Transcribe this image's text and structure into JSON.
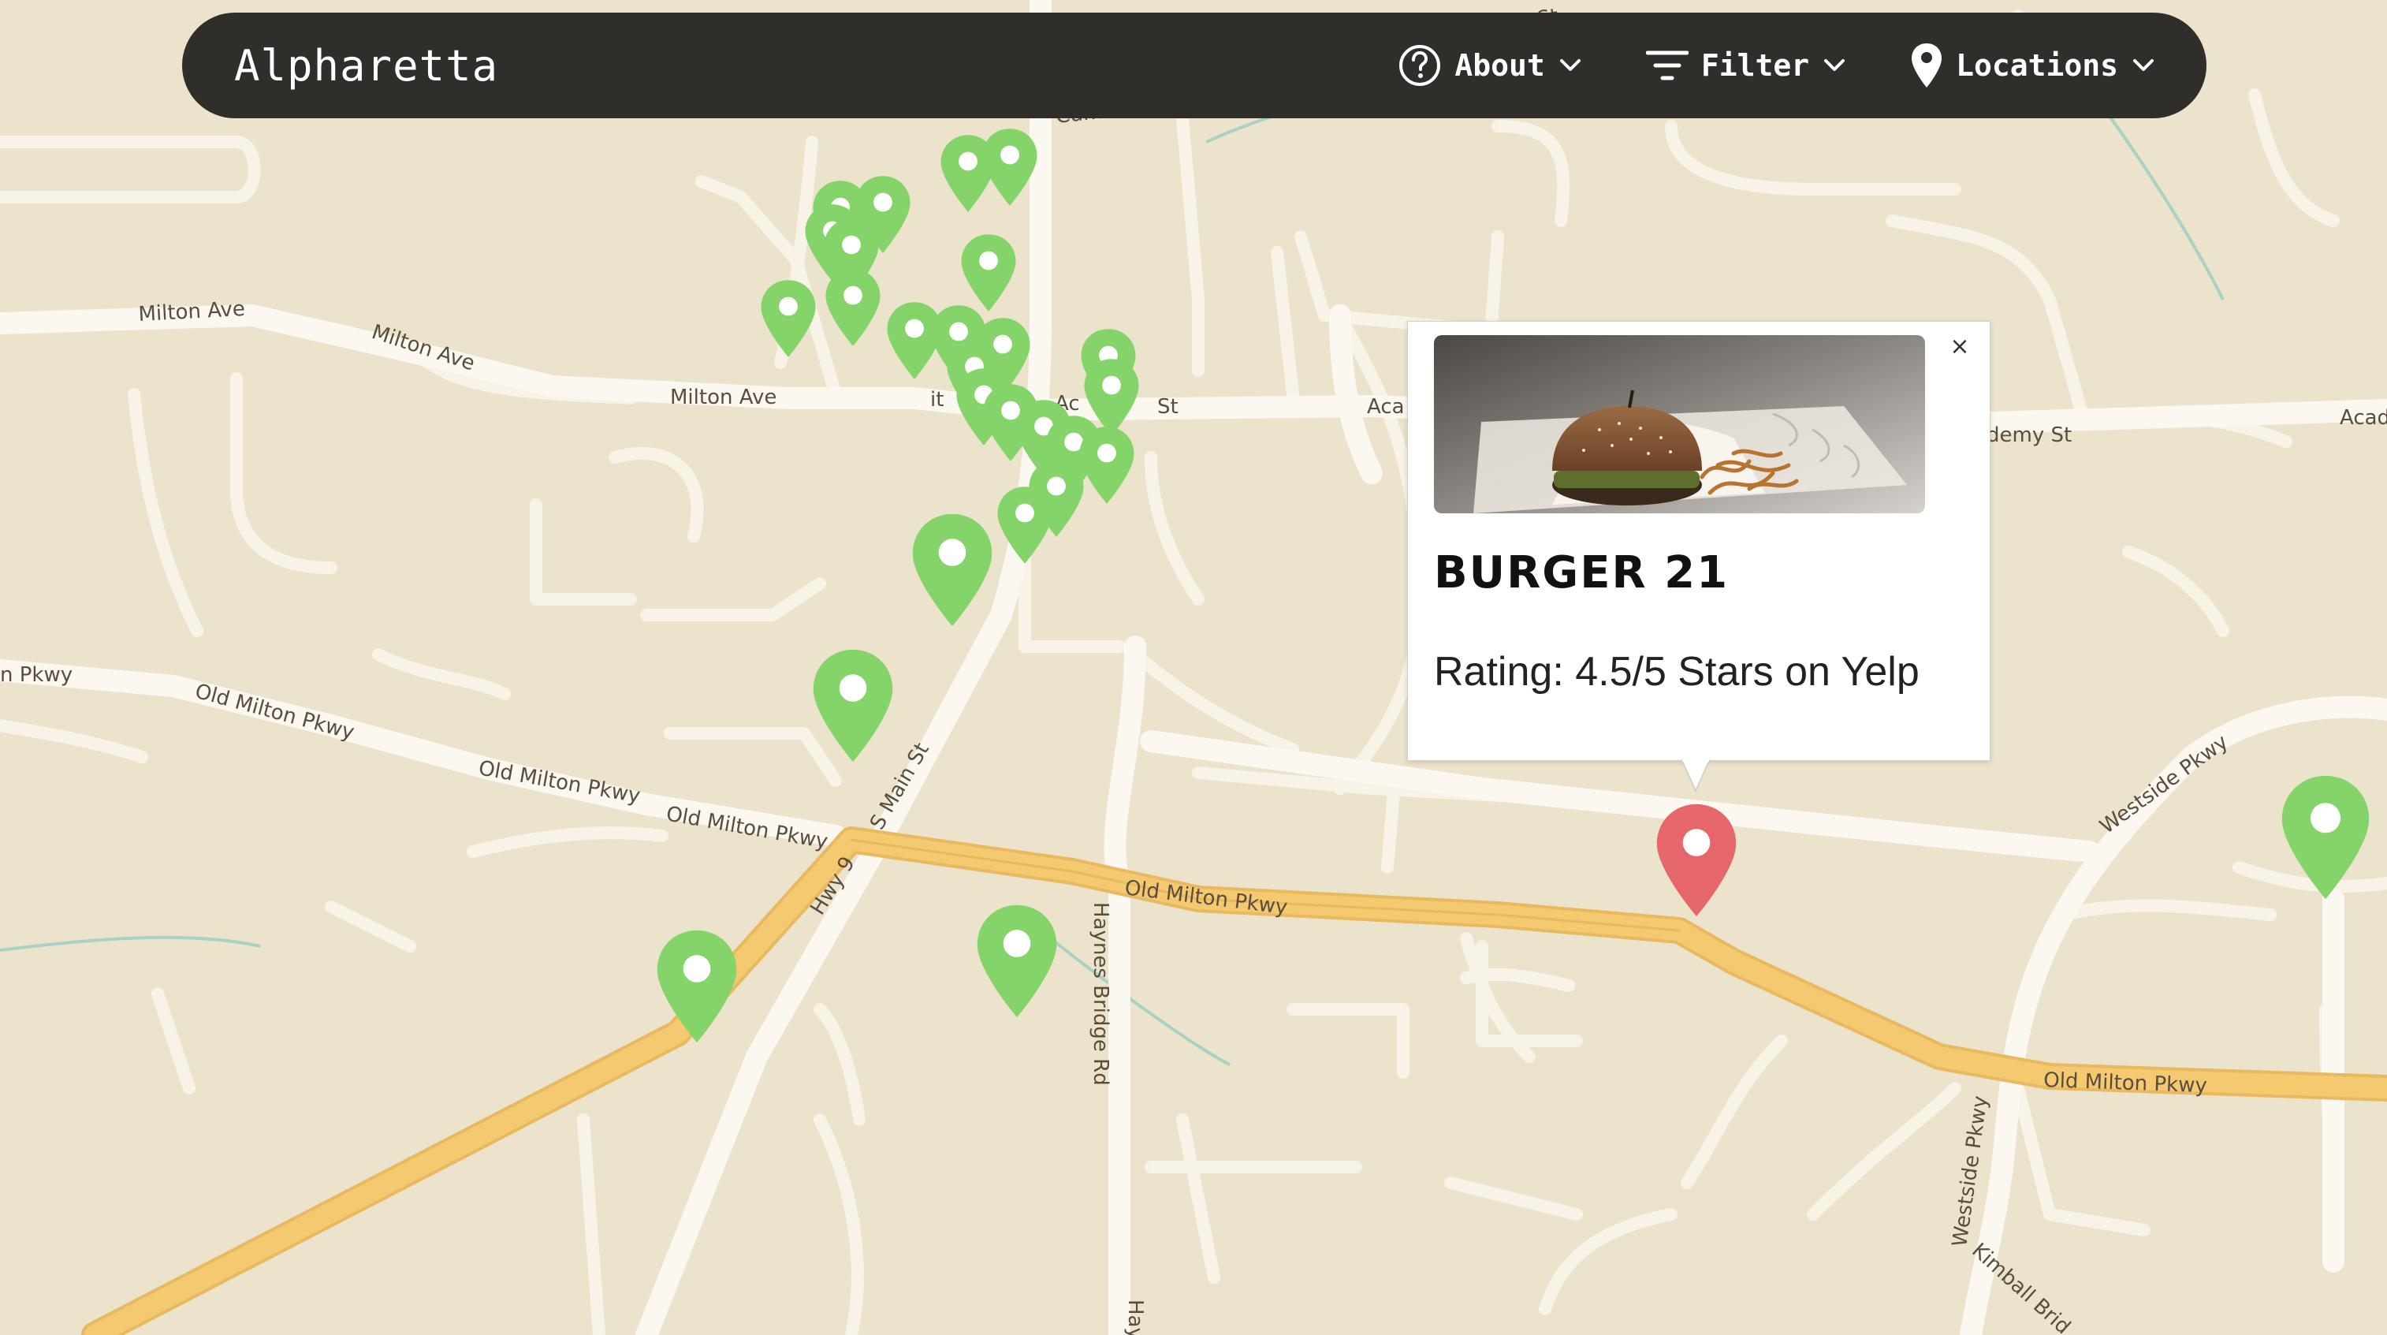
{
  "header": {
    "title": "Alpharetta",
    "nav": {
      "about": "About",
      "filter": "Filter",
      "locations": "Locations"
    }
  },
  "popup": {
    "title": "BURGER 21",
    "rating": "Rating: 4.5/5 Stars on Yelp",
    "close": "×",
    "image": "burger-and-fries-photo"
  },
  "map": {
    "streets": {
      "cumming_st_top": "Cumming St",
      "cumming_st": "Cumming St",
      "milton_ave_1": "Milton Ave",
      "milton_ave_2": "Milton Ave",
      "milton_ave_3": "Milton Ave",
      "academy_st_1": "Aca",
      "academy_st_2": "demy St",
      "academy_st_3": "Acad",
      "st_fragment_1": "it",
      "st_fragment_2": "Ac",
      "st_fragment_3": "St",
      "pkwy_left": "n Pkwy",
      "old_milton_1": "Old Milton Pkwy",
      "old_milton_2": "Old Milton Pkwy",
      "old_milton_3": "Old Milton Pkwy",
      "old_milton_4": "Old Milton Pkwy",
      "old_milton_5": "Old Milton Pkwy",
      "s_main_st": "S Main St",
      "hwy_9": "Hwy 9",
      "haynes_bridge": "Haynes Bridge Rd",
      "haynes_bottom": "Hay",
      "westside_pkwy_1": "Westside Pkwy",
      "westside_pkwy_2": "Westside Pkwy",
      "kimball_bridge": "Kimball Brid"
    }
  },
  "colors": {
    "map_background": "#ece3cd",
    "road": "#fbf8f1",
    "highway": "#f2c66d",
    "marker_green": "#85d46a",
    "marker_selected": "#e5676c",
    "navbar": "#2f2e2a"
  }
}
